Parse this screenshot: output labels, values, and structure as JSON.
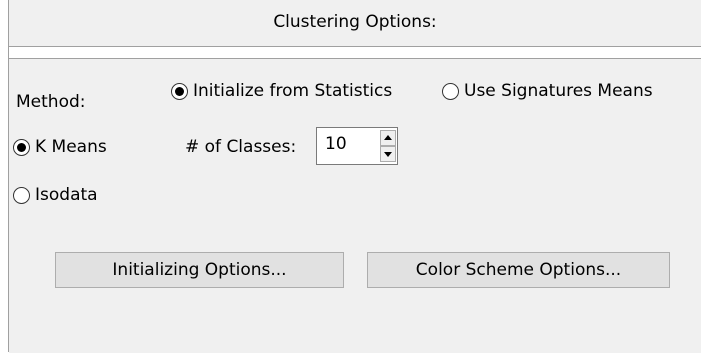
{
  "header": {
    "title": "Clustering Options:"
  },
  "method": {
    "label": "Method:",
    "options": [
      {
        "label": "Initialize from Statistics",
        "checked": true
      },
      {
        "label": "Use Signatures Means",
        "checked": false
      }
    ]
  },
  "algorithm": {
    "options": [
      {
        "label": "K Means",
        "checked": true
      },
      {
        "label": "Isodata",
        "checked": false
      }
    ]
  },
  "classes": {
    "label": "# of Classes:",
    "value": "10"
  },
  "buttons": {
    "initializing": "Initializing Options...",
    "color_scheme": "Color Scheme Options..."
  }
}
